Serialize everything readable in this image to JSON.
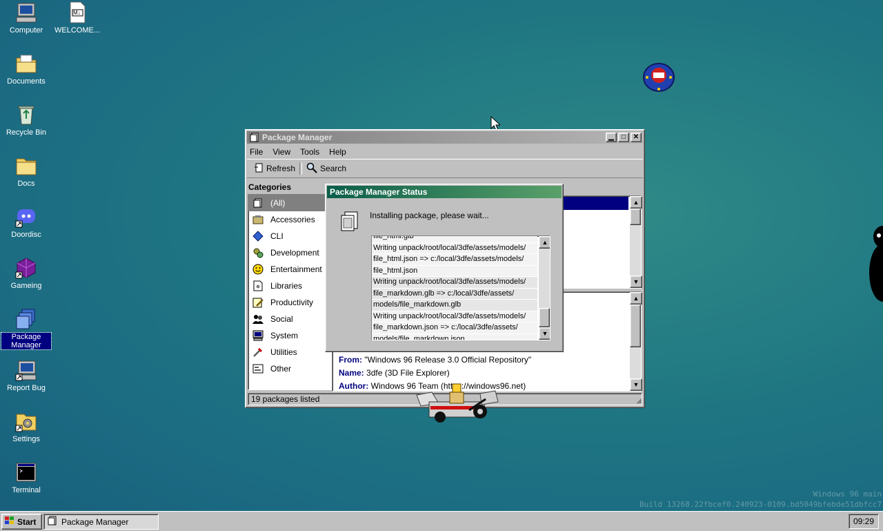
{
  "desktop": {
    "icons": [
      {
        "label": "Computer"
      },
      {
        "label": "WELCOME...",
        "badge": "M↓"
      },
      {
        "label": "Documents"
      },
      {
        "label": "Recycle Bin"
      },
      {
        "label": "Docs"
      },
      {
        "label": "Doordisc"
      },
      {
        "label": "Gameing"
      },
      {
        "label": "Package Manager"
      },
      {
        "label": "Report Bug"
      },
      {
        "label": "Settings"
      },
      {
        "label": "Terminal"
      }
    ],
    "watermark": {
      "line1": "Windows 96 main",
      "line2": "Build 13268.22fbcef0.240923-0109.bd5049bfebde51dbfcc7"
    }
  },
  "window": {
    "title": "Package Manager",
    "menu": [
      "File",
      "View",
      "Tools",
      "Help"
    ],
    "toolbar": {
      "refresh": "Refresh",
      "search": "Search"
    },
    "categories_heading": "Categories",
    "categories": [
      "(All)",
      "Accessories",
      "CLI",
      "Development",
      "Entertainment",
      "Libraries",
      "Productivity",
      "Social",
      "System",
      "Utilities",
      "Other"
    ],
    "selected_category": "(All)",
    "details": {
      "from_label": "From:",
      "from_value": "\"Windows 96 Release 3.0 Official Repository\"",
      "name_label": "Name:",
      "name_value": "3dfe (3D File Explorer)",
      "author_label": "Author:",
      "author_value": "Windows 96 Team (https://windows96.net)"
    },
    "status": "19 packages listed"
  },
  "dialog": {
    "title": "Package Manager Status",
    "message": "Installing package, please wait...",
    "log": [
      "file_html.glb",
      "Writing unpack/root/local/3dfe/assets/models/",
      "file_html.json => c:/local/3dfe/assets/models/",
      "file_html.json",
      "Writing unpack/root/local/3dfe/assets/models/",
      "file_markdown.glb => c:/local/3dfe/assets/",
      "models/file_markdown.glb",
      "Writing unpack/root/local/3dfe/assets/models/",
      "file_markdown.json => c:/local/3dfe/assets/",
      "models/file_markdown.json"
    ]
  },
  "taskbar": {
    "start": "Start",
    "task": "Package Manager",
    "clock": "09:29"
  },
  "colors": {
    "accent": "#000080",
    "dialog_title": "#0b5e4a"
  }
}
